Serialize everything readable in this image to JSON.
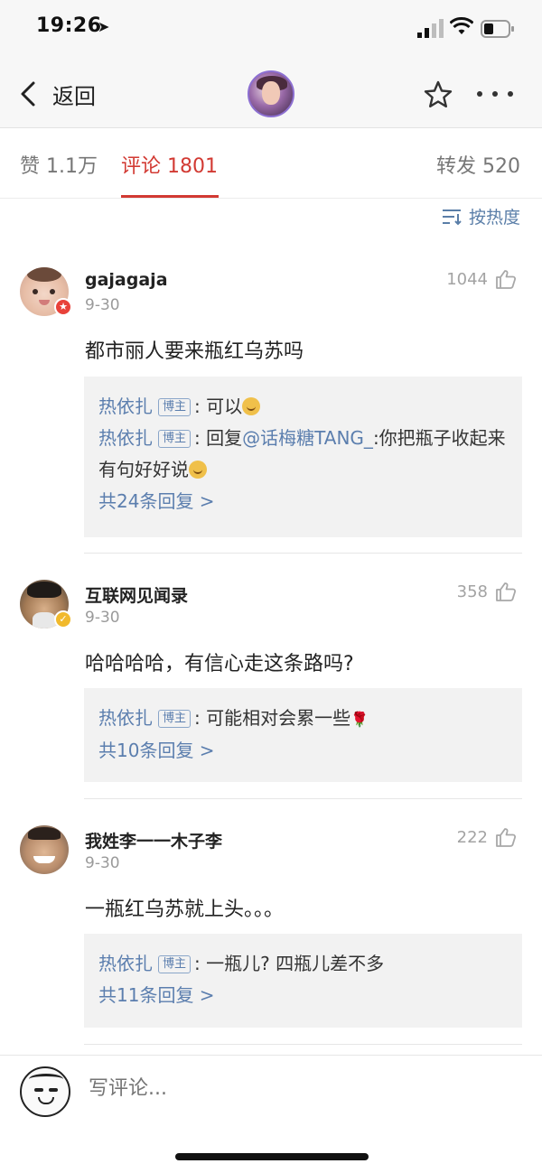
{
  "status_bar": {
    "time": "19:26",
    "location_arrow": "➤"
  },
  "nav": {
    "back_label": "返回"
  },
  "tabs": {
    "likes": "赞 1.1万",
    "comments": "评论 1801",
    "reposts": "转发 520"
  },
  "sort": {
    "label": "按热度"
  },
  "comments": [
    {
      "name": "gajagaja",
      "date": "9-30",
      "likes": "1044",
      "text": "都市丽人要来瓶红乌苏吗",
      "replies": [
        {
          "author": "热依扎",
          "tag": "博主",
          "sep": ": ",
          "text": "可以"
        },
        {
          "author": "热依扎",
          "tag": "博主",
          "sep": ": ",
          "prefix": "回复",
          "mention": "@话梅糖TANG_",
          "text": ":你把瓶子收起来 有句好好说"
        }
      ],
      "more": "共24条回复 >"
    },
    {
      "name": "互联网见闻录",
      "date": "9-30",
      "likes": "358",
      "text": "哈哈哈哈，有信心走这条路吗?",
      "replies": [
        {
          "author": "热依扎",
          "tag": "博主",
          "sep": ": ",
          "text": "可能相对会累一些"
        }
      ],
      "more": "共10条回复 >"
    },
    {
      "name": "我姓李一一木子李",
      "date": "9-30",
      "likes": "222",
      "text": "一瓶红乌苏就上头。。。",
      "replies": [
        {
          "author": "热依扎",
          "tag": "博主",
          "sep": ": ",
          "text": "一瓶儿? 四瓶儿差不多"
        }
      ],
      "more": "共11条回复 >"
    }
  ],
  "compose": {
    "placeholder": "写评论..."
  },
  "colors": {
    "accent": "#d23a33",
    "link": "#5b7eae"
  }
}
